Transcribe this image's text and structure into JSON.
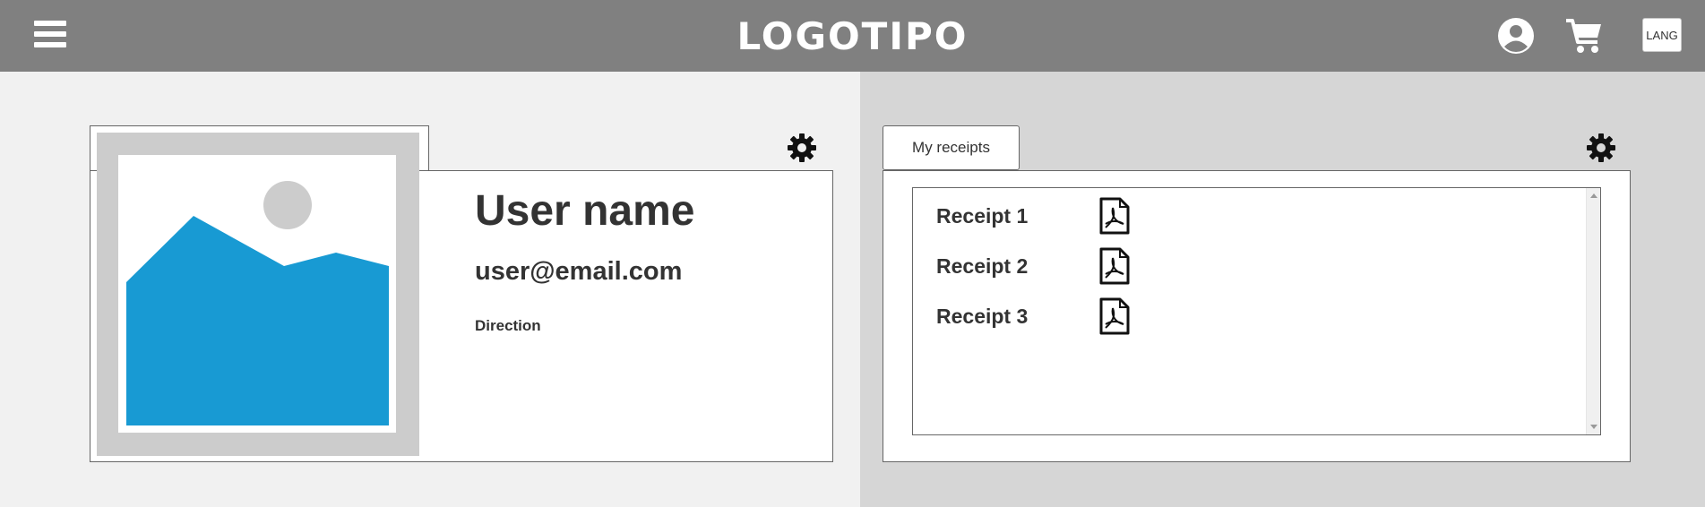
{
  "header": {
    "logo_text": "LOGOTIPO",
    "lang_label": "LANG",
    "icons": [
      "menu-icon",
      "user-icon",
      "cart-icon"
    ]
  },
  "profile": {
    "user_name": "User name",
    "email": "user@email.com",
    "direction": "Direction",
    "icons": [
      "image-placeholder-icon",
      "gear-icon"
    ]
  },
  "receipts": {
    "tab_label": "My receipts",
    "items": [
      {
        "label": "Receipt 1",
        "icon": "pdf-icon"
      },
      {
        "label": "Receipt 2",
        "icon": "pdf-icon"
      },
      {
        "label": "Receipt 3",
        "icon": "pdf-icon"
      }
    ]
  },
  "colors": {
    "header_bg": "#808080",
    "left_panel_bg": "#f1f1f1",
    "right_panel_bg": "#d6d6d6",
    "image_placeholder_blue": "#189ad3",
    "image_placeholder_gray": "#cccccc"
  }
}
